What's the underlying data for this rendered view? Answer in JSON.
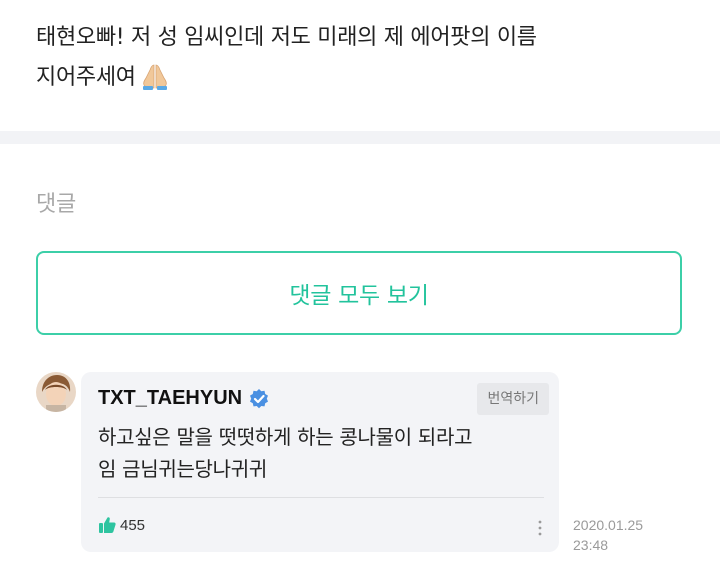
{
  "post": {
    "line1": "태현오빠! 저 성 임씨인데 저도 미래의 제 에어팟의 이름",
    "line2": "지어주세여",
    "emoji": "folded-hands-emoji"
  },
  "comments_section": {
    "label": "댓글",
    "view_all_label": "댓글 모두 보기"
  },
  "comment": {
    "author": "TXT_TAEHYUN",
    "verified_icon": "verified-check-icon",
    "translate_label": "번역하기",
    "body_line1": "하고싶은 말을 떳떳하게 하는 콩나물이 되라고",
    "body_line2": "임 금님귀는당나귀귀",
    "like_icon": "thumbs-up-icon",
    "like_count": "455",
    "more_icon": "more-vertical-icon",
    "date": "2020.01.25",
    "time": "23:48"
  },
  "colors": {
    "accent": "#22c39c",
    "accent_border": "#3ccfa8",
    "verified": "#4a90e2",
    "like": "#2ec4a0",
    "bubble_bg": "#f3f4f7",
    "divider_band": "#f2f3f6"
  }
}
